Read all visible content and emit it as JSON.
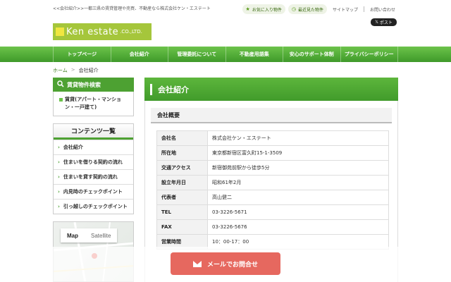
{
  "header": {
    "tagline": "<<会社紹介>>一都三県の賃貸管理や売買、不動産なら株式会社ケン・エステート",
    "favorites_label": "お気に入り物件",
    "recent_label": "最近見た物件",
    "sitemap_label": "サイトマップ",
    "contact_label": "お問い合わせ",
    "xpost_label": "ポスト",
    "logo_main": "Ken estate",
    "logo_suffix": ".CO.,LTD."
  },
  "nav": {
    "items": [
      "トップページ",
      "会社紹介",
      "管理委託について",
      "不動産用語集",
      "安心のサポート体制",
      "プライバシーポリシー"
    ]
  },
  "breadcrumb": {
    "home": "ホーム",
    "separator": ">",
    "current": "会社紹介"
  },
  "sidebar": {
    "search_title": "賃貸物件検索",
    "search_link": "賃貸(アパート・マンション・一戸建て)",
    "contents_title": "コンテンツ一覧",
    "contents_items": [
      "会社紹介",
      "住まいを借りる契約の流れ",
      "住まいを貸す契約の流れ",
      "内見時のチェックポイント",
      "引っ越しのチェックポイント"
    ],
    "map_tab_map": "Map",
    "map_tab_satellite": "Satellite"
  },
  "main": {
    "page_title": "会社紹介",
    "section_title": "会社概要",
    "rows": [
      {
        "k": "会社名",
        "v": "株式会社ケン・エステート"
      },
      {
        "k": "所在地",
        "v": "東京都新宿区富久町15-1-3509"
      },
      {
        "k": "交通アクセス",
        "v": "新宿御苑前駅から徒歩5分"
      },
      {
        "k": "設立年月日",
        "v": "昭和61年2月"
      },
      {
        "k": "代表者",
        "v": "高山健二"
      },
      {
        "k": "TEL",
        "v": "03-3226-5671"
      },
      {
        "k": "FAX",
        "v": "03-3226-5676"
      },
      {
        "k": "営業時間",
        "v": "10：00-17：00"
      }
    ]
  },
  "cta": {
    "mail_label": "メールでお問合せ"
  },
  "colors": {
    "accent_green": "#4da132",
    "cta_red": "#e6685f",
    "logo_green": "#a5c63b"
  }
}
